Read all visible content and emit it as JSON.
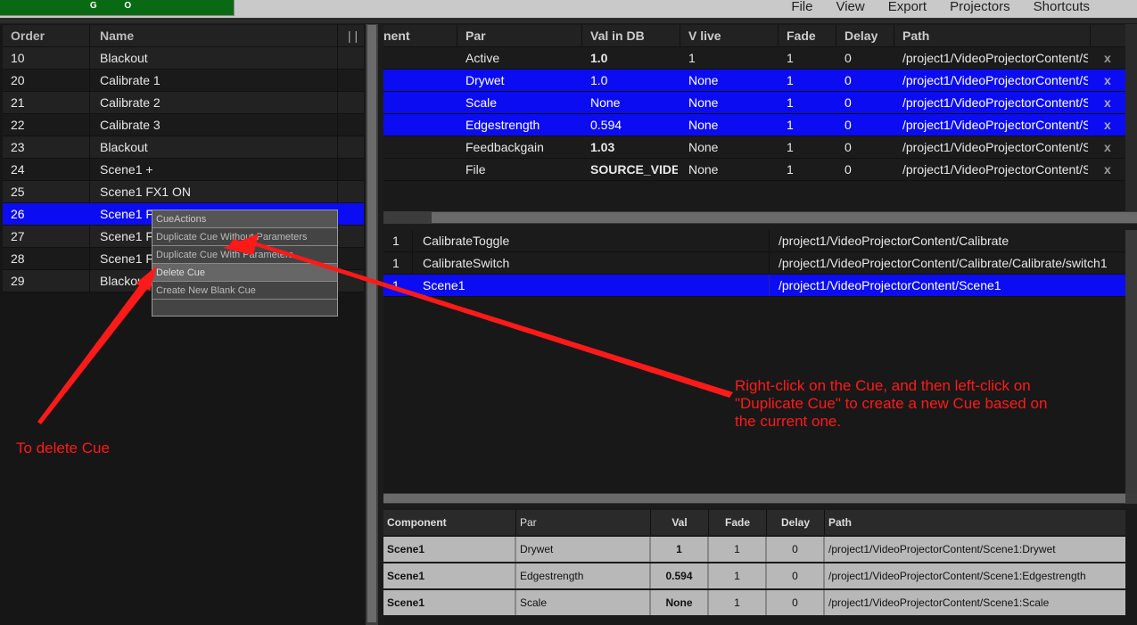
{
  "top": {
    "go_label": "G O",
    "menu": [
      "File",
      "View",
      "Export",
      "Projectors",
      "Shortcuts"
    ]
  },
  "cues": {
    "headers": {
      "order": "Order",
      "name": "Name",
      "resize": "| |"
    },
    "rows": [
      {
        "order": "10",
        "name": "Blackout"
      },
      {
        "order": "20",
        "name": "Calibrate 1"
      },
      {
        "order": "21",
        "name": "Calibrate 2"
      },
      {
        "order": "22",
        "name": "Calibrate 3"
      },
      {
        "order": "23",
        "name": "Blackout"
      },
      {
        "order": "24",
        "name": "Scene1 +"
      },
      {
        "order": "25",
        "name": "Scene1 FX1 ON"
      },
      {
        "order": "26",
        "name": "Scene1 FX",
        "selected": true
      },
      {
        "order": "27",
        "name": "Scene1 FX"
      },
      {
        "order": "28",
        "name": "Scene1 FX"
      },
      {
        "order": "29",
        "name": "Blackout"
      }
    ]
  },
  "context_menu": {
    "title": "CueActions",
    "items": [
      "Duplicate Cue Without Parameters",
      "Duplicate Cue With Parameters",
      "Delete Cue",
      "Create New Blank Cue"
    ]
  },
  "params_table": {
    "headers": [
      "nent",
      "Par",
      "Val in DB",
      "V live",
      "Fade",
      "Delay",
      "Path"
    ],
    "rows": [
      {
        "par": "Active",
        "val": "1.0",
        "live": "1",
        "fade": "1",
        "delay": "0",
        "path": "/project1/VideoProjectorContent/S",
        "x": "x",
        "bold": true,
        "blue": false
      },
      {
        "par": "Drywet",
        "val": "1.0",
        "live": "None",
        "fade": "1",
        "delay": "0",
        "path": "/project1/VideoProjectorContent/S",
        "x": "x",
        "bold": false,
        "blue": true
      },
      {
        "par": "Scale",
        "val": "None",
        "live": "None",
        "fade": "1",
        "delay": "0",
        "path": "/project1/VideoProjectorContent/S",
        "x": "x",
        "bold": false,
        "blue": true
      },
      {
        "par": "Edgestrength",
        "val": "0.594",
        "live": "None",
        "fade": "1",
        "delay": "0",
        "path": "/project1/VideoProjectorContent/S",
        "x": "x",
        "bold": false,
        "blue": true
      },
      {
        "par": "Feedbackgain",
        "val": "1.03",
        "live": "None",
        "fade": "1",
        "delay": "0",
        "path": "/project1/VideoProjectorContent/S",
        "x": "x",
        "bold": true,
        "blue": false
      },
      {
        "par": "File",
        "val": "SOURCE_VIDEO",
        "live": "None",
        "fade": "1",
        "delay": "0",
        "path": "/project1/VideoProjectorContent/S",
        "x": "x",
        "bold": true,
        "blue": false
      }
    ]
  },
  "components_list": {
    "rows": [
      {
        "num": "1",
        "name": "CalibrateToggle",
        "path": "/project1/VideoProjectorContent/Calibrate",
        "selected": false
      },
      {
        "num": "1",
        "name": "CalibrateSwitch",
        "path": "/project1/VideoProjectorContent/Calibrate/Calibrate/switch1",
        "selected": false
      },
      {
        "num": "1",
        "name": "Scene1",
        "path": "/project1/VideoProjectorContent/Scene1",
        "selected": true
      }
    ]
  },
  "bottom_table": {
    "headers": [
      "Component",
      "Par",
      "Val",
      "Fade",
      "Delay",
      "Path"
    ],
    "rows": [
      {
        "component": "Scene1",
        "par": "Drywet",
        "val": "1",
        "fade": "1",
        "delay": "0",
        "path": "/project1/VideoProjectorContent/Scene1:Drywet"
      },
      {
        "component": "Scene1",
        "par": "Edgestrength",
        "val": "0.594",
        "fade": "1",
        "delay": "0",
        "path": "/project1/VideoProjectorContent/Scene1:Edgestrength"
      },
      {
        "component": "Scene1",
        "par": "Scale",
        "val": "None",
        "fade": "1",
        "delay": "0",
        "path": "/project1/VideoProjectorContent/Scene1:Scale"
      }
    ]
  },
  "annotations": {
    "duplicate_note_lines": [
      "Right-click on the Cue, and then left-click on",
      "\"Duplicate Cue\" to create a new Cue based on",
      "the current one."
    ],
    "delete_note": "To delete Cue",
    "color": "#ff1a1a"
  }
}
